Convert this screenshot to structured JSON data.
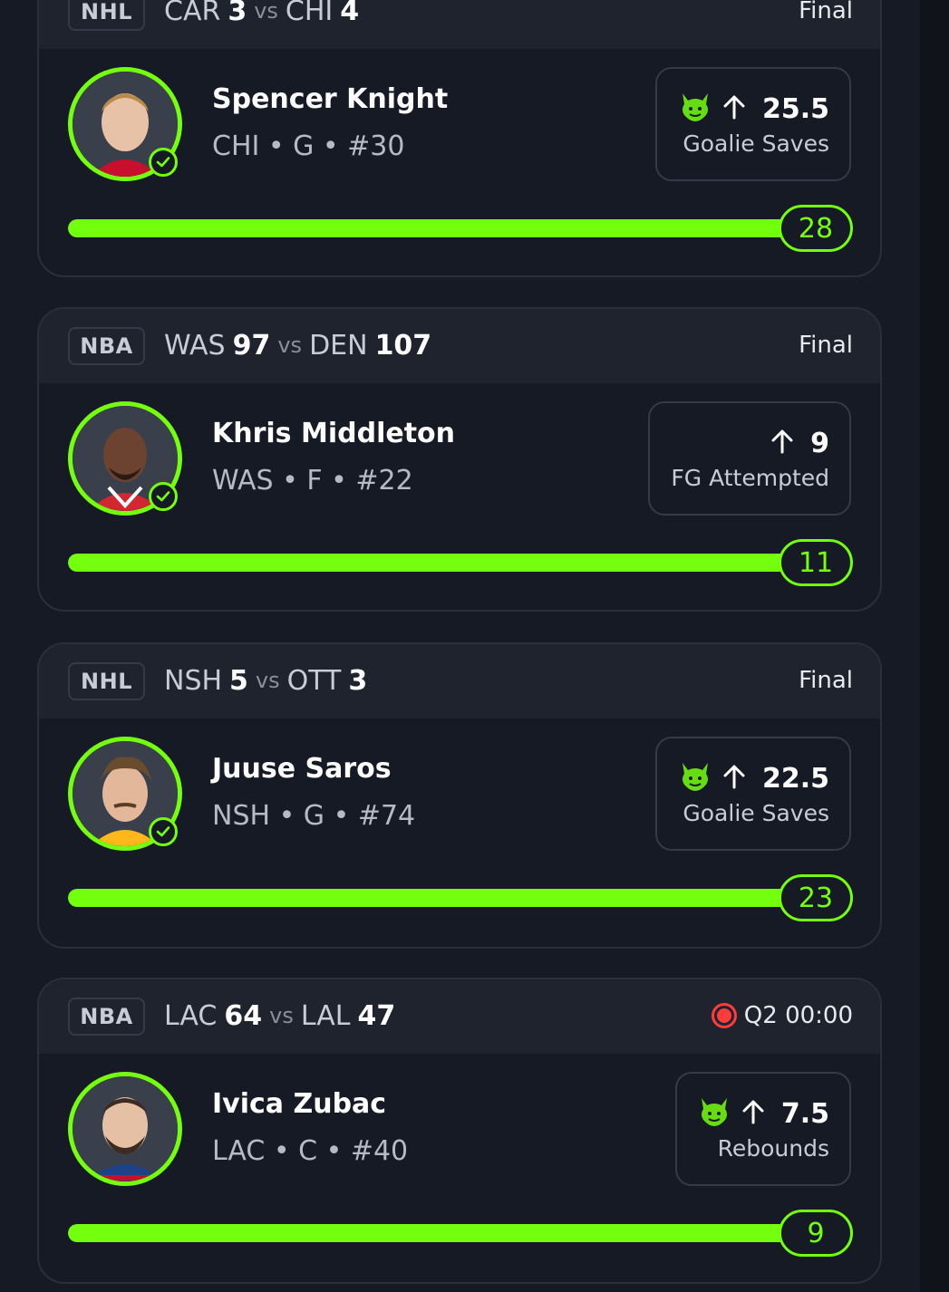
{
  "colors": {
    "accent": "#74ff0f",
    "live": "#ff3b3b",
    "background": "#161a24",
    "header": "#1f232e"
  },
  "cards": [
    {
      "league": "NHL",
      "away_team": "CAR",
      "away_score": "3",
      "vs": "vs",
      "home_team": "CHI",
      "home_score": "4",
      "status": "Final",
      "player_name": "Spencer Knight",
      "player_meta": "CHI • G • #30",
      "direction_icon": "arrow-up-icon",
      "has_demon": true,
      "line": "25.5",
      "stat": "Goalie Saves",
      "result": "28",
      "progress": 1.0
    },
    {
      "league": "NBA",
      "away_team": "WAS",
      "away_score": "97",
      "vs": "vs",
      "home_team": "DEN",
      "home_score": "107",
      "status": "Final",
      "player_name": "Khris Middleton",
      "player_meta": "WAS • F • #22",
      "direction_icon": "arrow-up-icon",
      "has_demon": false,
      "line": "9",
      "stat": "FG Attempted",
      "result": "11",
      "progress": 1.0
    },
    {
      "league": "NHL",
      "away_team": "NSH",
      "away_score": "5",
      "vs": "vs",
      "home_team": "OTT",
      "home_score": "3",
      "status": "Final",
      "player_name": "Juuse Saros",
      "player_meta": "NSH • G • #74",
      "direction_icon": "arrow-up-icon",
      "has_demon": true,
      "line": "22.5",
      "stat": "Goalie Saves",
      "result": "23",
      "progress": 1.0
    },
    {
      "league": "NBA",
      "away_team": "LAC",
      "away_score": "64",
      "vs": "vs",
      "home_team": "LAL",
      "home_score": "47",
      "status": "Q2 00:00",
      "is_live": true,
      "player_name": "Ivica Zubac",
      "player_meta": "LAC • C • #40",
      "direction_icon": "arrow-up-icon",
      "has_demon": true,
      "line": "7.5",
      "stat": "Rebounds",
      "result": "9",
      "progress": 1.0
    }
  ]
}
